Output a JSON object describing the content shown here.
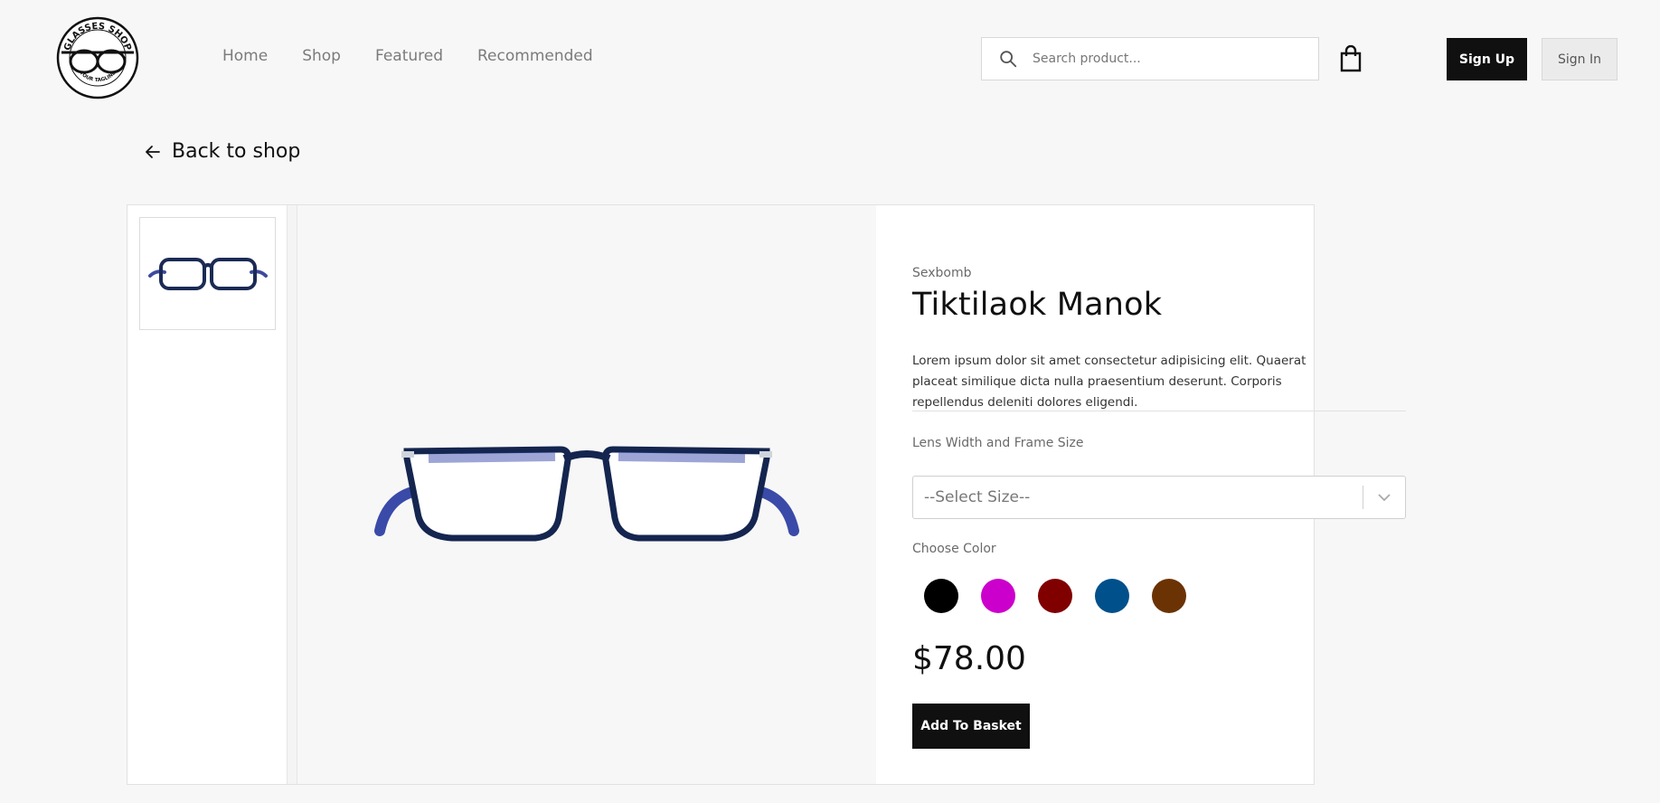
{
  "brand": {
    "logo_top_text": "GLASSES SHOP",
    "logo_bottom_text": "YOUR TAGLINE"
  },
  "nav": {
    "items": [
      "Home",
      "Shop",
      "Featured",
      "Recommended"
    ]
  },
  "search": {
    "placeholder": "Search product...",
    "icon": "search-icon"
  },
  "header": {
    "basket_icon": "shopping-bag-icon",
    "signup_label": "Sign Up",
    "signin_label": "Sign In"
  },
  "back": {
    "label": "Back to shop",
    "icon": "arrow-left-icon"
  },
  "product": {
    "brand": "Sexbomb",
    "name": "Tiktilaok Manok",
    "description": "Lorem ipsum dolor sit amet consectetur adipisicing elit. Quaerat placeat similique dicta nulla praesentium deserunt. Corporis repellendus deleniti dolores eligendi.",
    "size_label": "Lens Width and Frame Size",
    "size_value": "--Select Size--",
    "color_label": "Choose Color",
    "colors": [
      "#000000",
      "#cc00cc",
      "#800000",
      "#00508c",
      "#6b3304"
    ],
    "price": "$78.00",
    "add_label": "Add To Basket"
  }
}
